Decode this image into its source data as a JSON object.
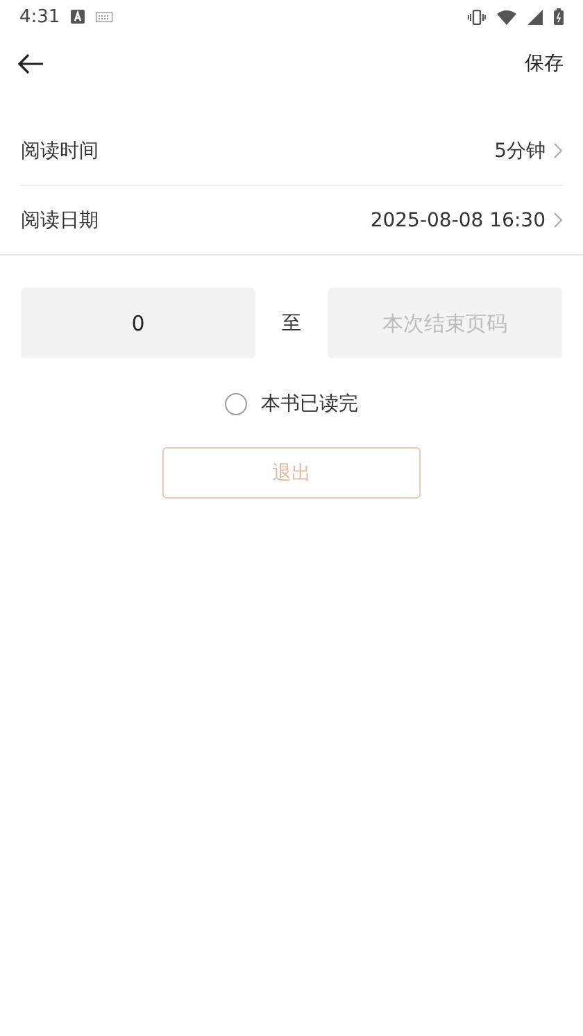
{
  "status_bar": {
    "time": "4:31"
  },
  "header": {
    "action": "保存"
  },
  "settings": [
    {
      "label": "阅读时间",
      "value": "5分钟"
    },
    {
      "label": "阅读日期",
      "value": "2025-08-08 16:30"
    }
  ],
  "page_range": {
    "start_value": "0",
    "separator": "至",
    "end_placeholder": "本次结束页码"
  },
  "finished": {
    "label": "本书已读完",
    "checked": false
  },
  "exit_button": {
    "label": "退出"
  }
}
